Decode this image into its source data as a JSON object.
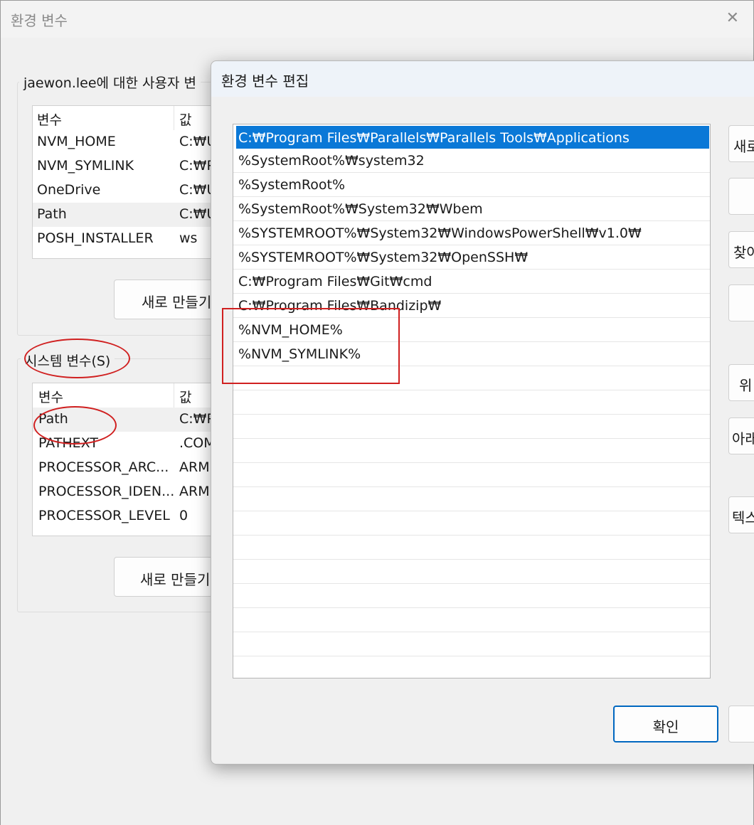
{
  "bg_window": {
    "title": "환경 변수",
    "close_glyph": "✕",
    "user_group_label": "jaewon.lee에 대한 사용자 변",
    "system_group_label": "시스템 변수(S)",
    "col_var": "변수",
    "col_val": "값",
    "user_vars": [
      {
        "name": "NVM_HOME",
        "value": "C:₩U"
      },
      {
        "name": "NVM_SYMLINK",
        "value": "C:₩P"
      },
      {
        "name": "OneDrive",
        "value": "C:₩U"
      },
      {
        "name": "Path",
        "value": "C:₩U"
      },
      {
        "name": "POSH_INSTALLER",
        "value": "ws"
      }
    ],
    "system_vars": [
      {
        "name": "Path",
        "value": "C:₩P"
      },
      {
        "name": "PATHEXT",
        "value": ".COM"
      },
      {
        "name": "PROCESSOR_ARC...",
        "value": "ARM"
      },
      {
        "name": "PROCESSOR_IDEN...",
        "value": "ARM"
      },
      {
        "name": "PROCESSOR_LEVEL",
        "value": "0"
      }
    ],
    "user_new_button": "새로 만들기",
    "system_new_button": "새로 만들기"
  },
  "edit_dialog": {
    "title": "환경 변수 편집",
    "paths": [
      "C:₩Program Files₩Parallels₩Parallels Tools₩Applications",
      "%SystemRoot%₩system32",
      "%SystemRoot%",
      "%SystemRoot%₩System32₩Wbem",
      "%SYSTEMROOT%₩System32₩WindowsPowerShell₩v1.0₩",
      "%SYSTEMROOT%₩System32₩OpenSSH₩",
      "C:₩Program Files₩Git₩cmd",
      "C:₩Program Files₩Bandizip₩",
      "%NVM_HOME%",
      "%NVM_SYMLINK%"
    ],
    "side_buttons": {
      "new": "새로",
      "edit": "",
      "browse": "찾아",
      "delete": "",
      "move_up": "위",
      "move_down": "아래",
      "edit_text": "텍스"
    },
    "ok_button": "확인",
    "cancel_button": ""
  },
  "colors": {
    "selection": "#0a78d7",
    "annotation": "#d02020",
    "ok_border": "#0067c0"
  }
}
